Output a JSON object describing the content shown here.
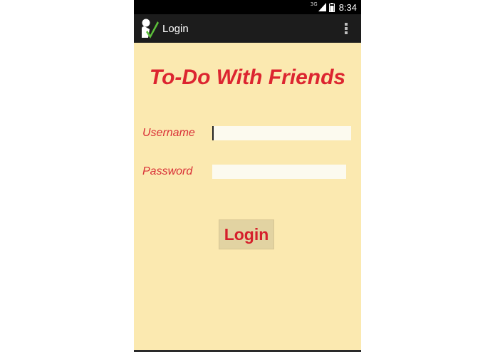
{
  "status_bar": {
    "network": "3G",
    "time": "8:34",
    "icons": [
      "signal-icon",
      "battery-icon"
    ]
  },
  "action_bar": {
    "title": "Login",
    "app_icon": "app-logo-icon",
    "overflow_icon": "overflow-menu-icon"
  },
  "app_title": "To-Do With Friends",
  "form": {
    "username_label": "Username",
    "username_value": "",
    "password_label": "Password",
    "password_value": ""
  },
  "login_button_label": "Login",
  "colors": {
    "background": "#fbe9b0",
    "accent_red": "#dc2530",
    "action_bar": "#1c1c1c",
    "button_bg": "#e2d3a2"
  }
}
